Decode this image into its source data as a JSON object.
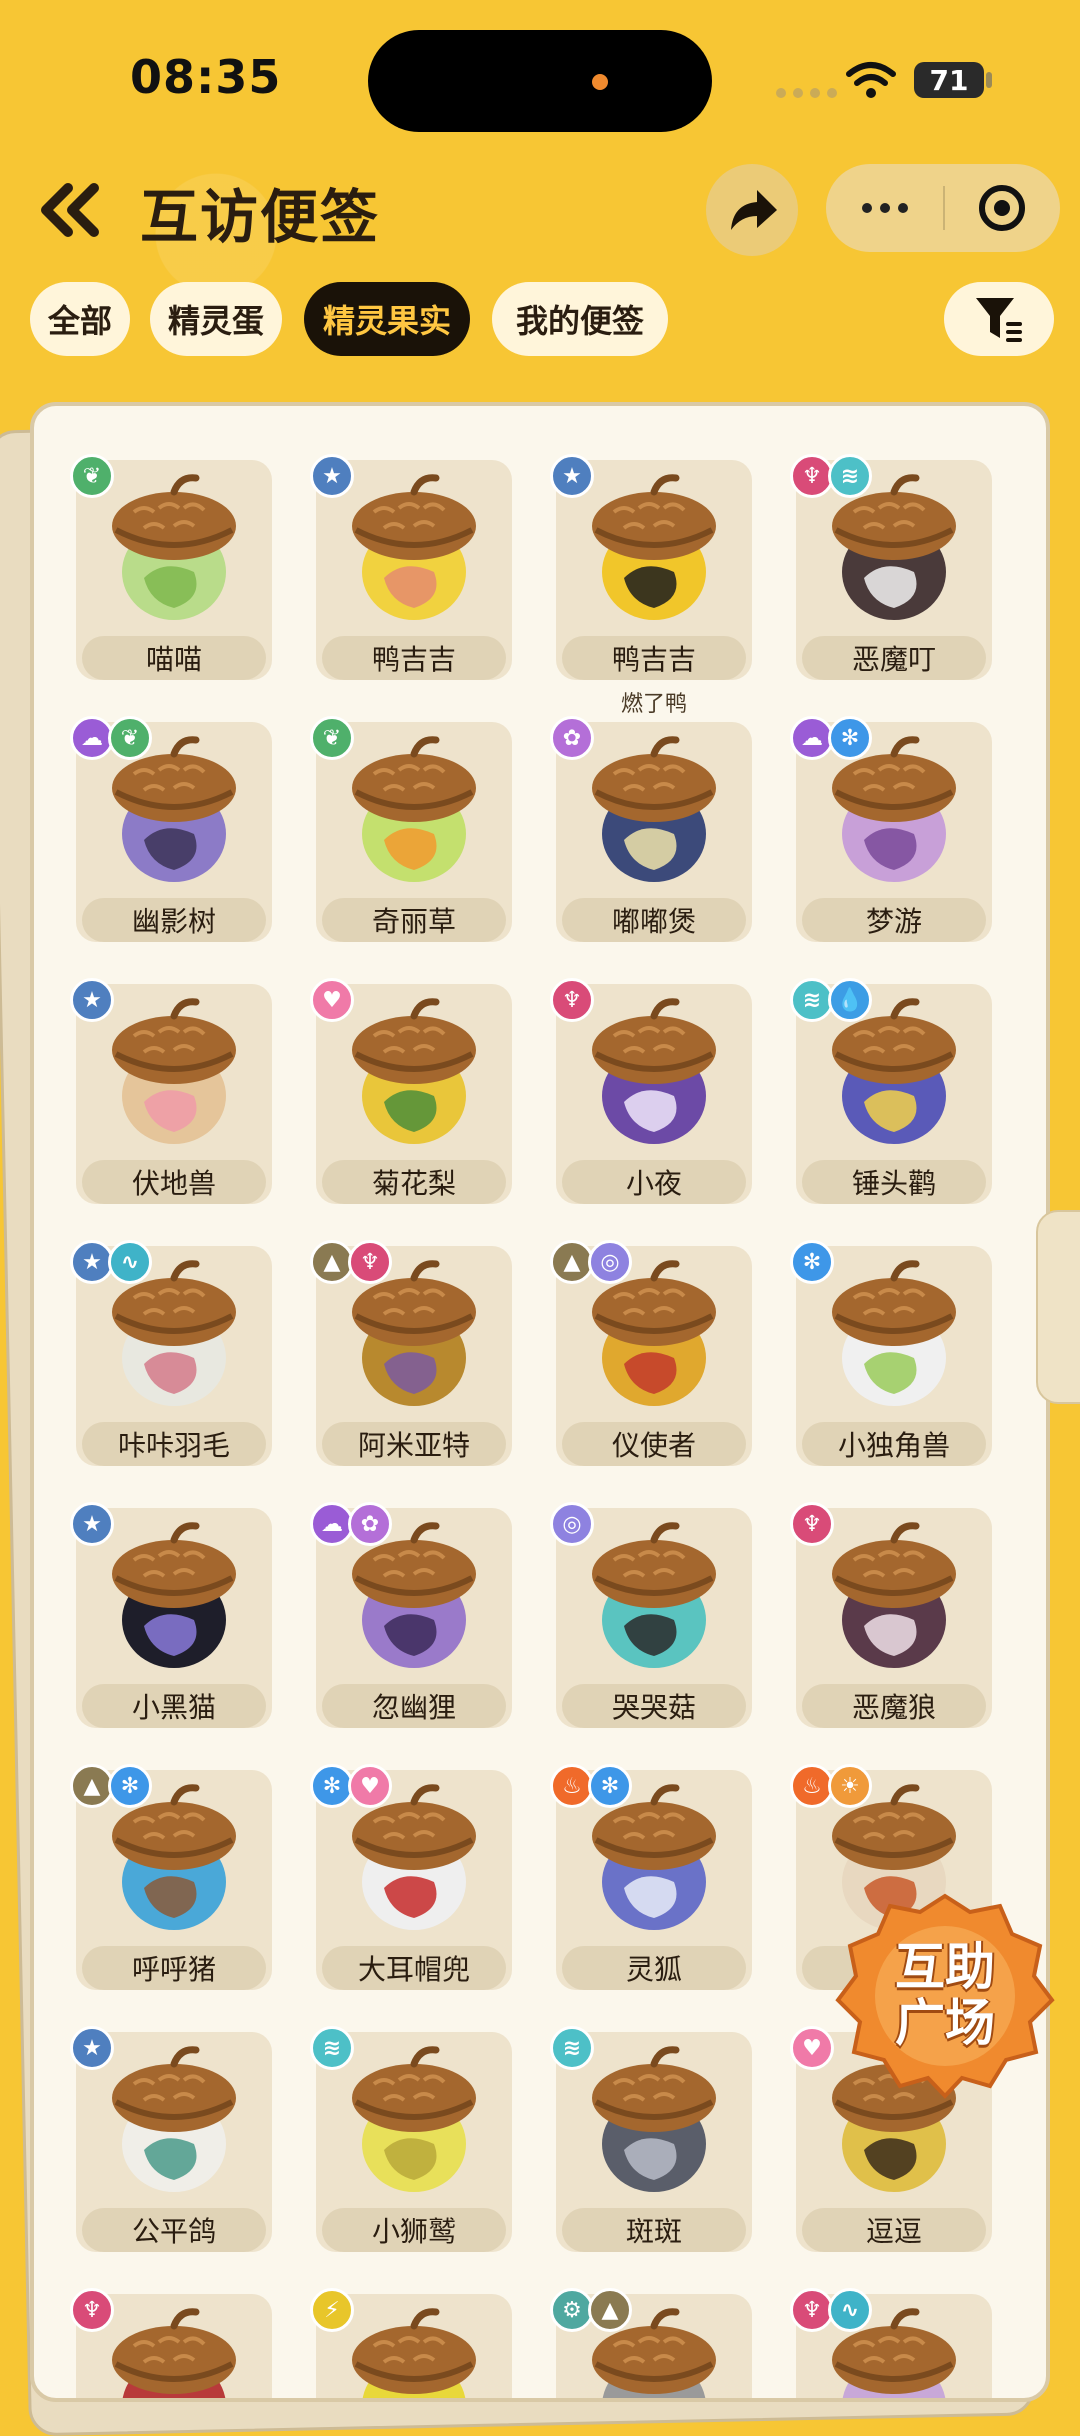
{
  "status": {
    "time": "08:35",
    "battery": "71"
  },
  "header": {
    "title": "互访便签"
  },
  "tabs": [
    {
      "label": "全部",
      "active": false
    },
    {
      "label": "精灵蛋",
      "active": false
    },
    {
      "label": "精灵果实",
      "active": true
    },
    {
      "label": "我的便签",
      "active": false
    }
  ],
  "items": [
    {
      "name": "喵喵",
      "sub": "",
      "badges": [
        "grass"
      ],
      "colors": [
        "#B9DC8A",
        "#7FB84E"
      ]
    },
    {
      "name": "鸭吉吉",
      "sub": "",
      "badges": [
        "normal"
      ],
      "colors": [
        "#F1D23F",
        "#E58C6E"
      ]
    },
    {
      "name": "鸭吉吉",
      "sub": "燃了鸭",
      "badges": [
        "normal"
      ],
      "colors": [
        "#F1C62A",
        "#1C1C1C"
      ]
    },
    {
      "name": "恶魔叮",
      "sub": "",
      "badges": [
        "demon",
        "wing"
      ],
      "colors": [
        "#4A3A3A",
        "#F2F2F2"
      ]
    },
    {
      "name": "幽影树",
      "sub": "",
      "badges": [
        "ghost",
        "grass"
      ],
      "colors": [
        "#8C7BC7",
        "#3C3458"
      ]
    },
    {
      "name": "奇丽草",
      "sub": "",
      "badges": [
        "grass"
      ],
      "colors": [
        "#C4E06E",
        "#F29A2F"
      ]
    },
    {
      "name": "嘟嘟煲",
      "sub": "",
      "badges": [
        "fantasy"
      ],
      "colors": [
        "#3C4A7A",
        "#EFE3AA"
      ]
    },
    {
      "name": "梦游",
      "sub": "",
      "badges": [
        "ghost",
        "ice"
      ],
      "colors": [
        "#C8A0D8",
        "#7A4A9A"
      ]
    },
    {
      "name": "伏地兽",
      "sub": "",
      "badges": [
        "normal"
      ],
      "colors": [
        "#E5C59A",
        "#F09AA8"
      ]
    },
    {
      "name": "菊花梨",
      "sub": "",
      "badges": [
        "cute"
      ],
      "colors": [
        "#E9C63A",
        "#4E8E3A"
      ]
    },
    {
      "name": "小夜",
      "sub": "",
      "badges": [
        "demon"
      ],
      "colors": [
        "#6C4AA6",
        "#F0E6FA"
      ]
    },
    {
      "name": "锤头鹳",
      "sub": "",
      "badges": [
        "wing",
        "water"
      ],
      "colors": [
        "#5A5AB8",
        "#F2D14A"
      ]
    },
    {
      "name": "咔咔羽毛",
      "sub": "",
      "badges": [
        "normal",
        "wind"
      ],
      "colors": [
        "#E8E8E0",
        "#D47A8A"
      ]
    },
    {
      "name": "阿米亚特",
      "sub": "",
      "badges": [
        "ground",
        "demon"
      ],
      "colors": [
        "#B8892E",
        "#7A5AA0"
      ]
    },
    {
      "name": "仪使者",
      "sub": "",
      "badges": [
        "ground",
        "psychic"
      ],
      "colors": [
        "#E0A82E",
        "#C23A2A"
      ]
    },
    {
      "name": "小独角兽",
      "sub": "",
      "badges": [
        "ice"
      ],
      "colors": [
        "#F0F0F0",
        "#9ACB5A"
      ]
    },
    {
      "name": "小黑猫",
      "sub": "",
      "badges": [
        "normal"
      ],
      "colors": [
        "#1E1E2A",
        "#8A7ADA"
      ]
    },
    {
      "name": "忽幽狸",
      "sub": "",
      "badges": [
        "ghost",
        "fantasy"
      ],
      "colors": [
        "#9A7ACA",
        "#3C2A5A"
      ]
    },
    {
      "name": "哭哭菇",
      "sub": "",
      "badges": [
        "psychic"
      ],
      "colors": [
        "#5AC4C0",
        "#2A2A2A"
      ]
    },
    {
      "name": "恶魔狼",
      "sub": "",
      "badges": [
        "demon"
      ],
      "colors": [
        "#5A3A4A",
        "#F0E0E8"
      ]
    },
    {
      "name": "呼呼猪",
      "sub": "",
      "badges": [
        "ground",
        "ice"
      ],
      "colors": [
        "#4AA8D8",
        "#8A5A3A"
      ]
    },
    {
      "name": "大耳帽兜",
      "sub": "",
      "badges": [
        "ice",
        "cute"
      ],
      "colors": [
        "#EFEFEF",
        "#C62A2A"
      ]
    },
    {
      "name": "灵狐",
      "sub": "",
      "badges": [
        "fire",
        "ice"
      ],
      "colors": [
        "#6A72C8",
        "#E8ECF8"
      ]
    },
    {
      "name": "",
      "sub": "",
      "badges": [
        "fire",
        "light"
      ],
      "colors": [
        "#E8D8C0",
        "#C85A2A"
      ]
    },
    {
      "name": "公平鸽",
      "sub": "",
      "badges": [
        "normal"
      ],
      "colors": [
        "#F0EEE8",
        "#4A9A8A"
      ]
    },
    {
      "name": "小狮鹫",
      "sub": "",
      "badges": [
        "wing"
      ],
      "colors": [
        "#E8E05A",
        "#B8A83A"
      ]
    },
    {
      "name": "斑斑",
      "sub": "",
      "badges": [
        "wing"
      ],
      "colors": [
        "#5A5E6A",
        "#B8BCC8"
      ]
    },
    {
      "name": "逗逗",
      "sub": "",
      "badges": [
        "cute"
      ],
      "colors": [
        "#E0C04A",
        "#3A2A1A"
      ]
    },
    {
      "name": "",
      "sub": "",
      "badges": [
        "demon"
      ],
      "colors": [
        "#B83A3A",
        "#E8C8C8"
      ]
    },
    {
      "name": "",
      "sub": "",
      "badges": [
        "electric"
      ],
      "colors": [
        "#E8D83A",
        "#B89A2A"
      ]
    },
    {
      "name": "",
      "sub": "",
      "badges": [
        "machine",
        "ground"
      ],
      "colors": [
        "#9A9A9A",
        "#6A6A6A"
      ]
    },
    {
      "name": "",
      "sub": "",
      "badges": [
        "demon",
        "wind"
      ],
      "colors": [
        "#C8A8D8",
        "#7A4A9A"
      ]
    }
  ],
  "badge_types": {
    "grass": {
      "color": "#4FB06B",
      "glyph": "❦"
    },
    "normal": {
      "color": "#4F7FBF",
      "glyph": "★"
    },
    "demon": {
      "color": "#D94B78",
      "glyph": "♆"
    },
    "wing": {
      "color": "#4DC0C7",
      "glyph": "≋"
    },
    "ghost": {
      "color": "#9A5CD6",
      "glyph": "☁"
    },
    "fantasy": {
      "color": "#B46FD8",
      "glyph": "✿"
    },
    "ice": {
      "color": "#3E97E8",
      "glyph": "✻"
    },
    "cute": {
      "color": "#F07AA8",
      "glyph": "♥"
    },
    "water": {
      "color": "#3C9DE5",
      "glyph": "💧"
    },
    "wind": {
      "color": "#3FB3C8",
      "glyph": "∿"
    },
    "ground": {
      "color": "#8A7A52",
      "glyph": "▲"
    },
    "psychic": {
      "color": "#8E82E0",
      "glyph": "◎"
    },
    "fire": {
      "color": "#F06A2A",
      "glyph": "♨"
    },
    "light": {
      "color": "#F09A3A",
      "glyph": "☀"
    },
    "electric": {
      "color": "#E8C62A",
      "glyph": "⚡"
    },
    "machine": {
      "color": "#4FA8A0",
      "glyph": "⚙"
    }
  },
  "help_button": {
    "line1": "互助",
    "line2": "广场"
  },
  "icons": {
    "back": "double-chevron-left-icon",
    "share": "share-arrow-icon",
    "more": "more-dots-icon",
    "close": "target-close-icon",
    "filter": "filter-icon"
  }
}
